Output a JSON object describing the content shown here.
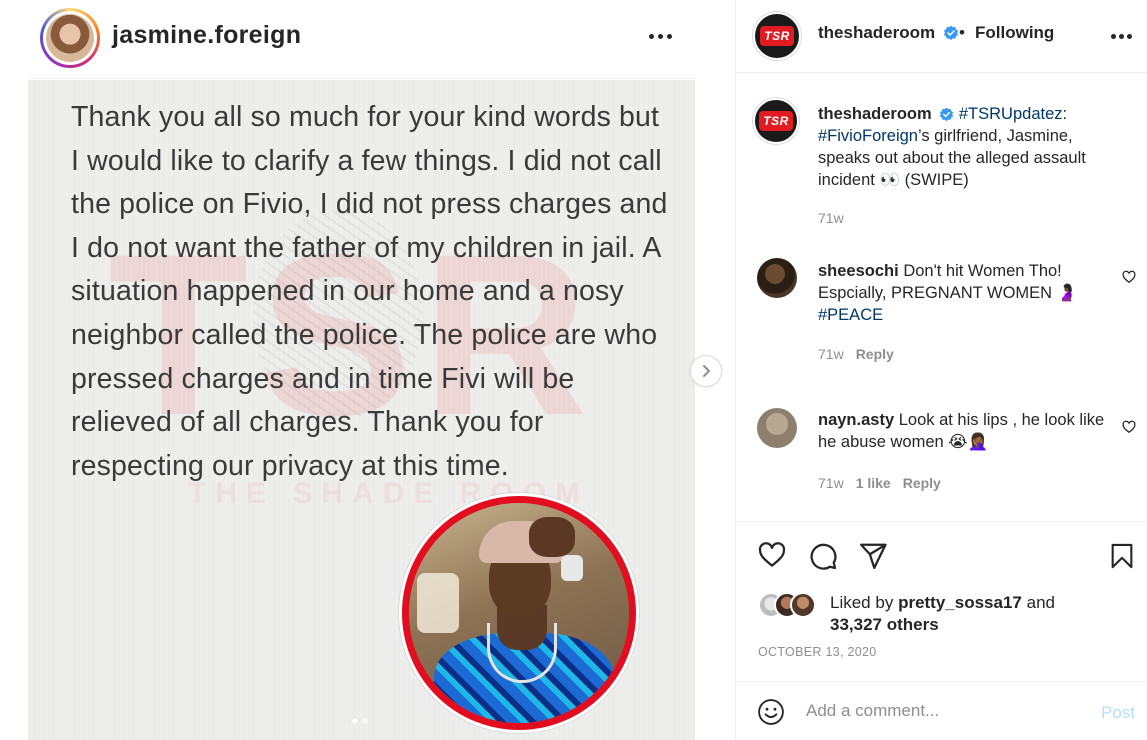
{
  "media": {
    "username": "jasmine.foreign",
    "statement": "Thank you all so much for your kind words but I would like to clarify a few things. I did not call the police on Fivio, I did not press charges and I do not want the father of my children in jail. A situation happened in our home and a nosy neighbor called the police. The police are who pressed charges and in time Fivi will be relieved of all charges. Thank you for respecting our privacy at this time.",
    "watermark_letters": "TSR",
    "watermark_text": "THE SHADE ROOM",
    "carousel_dots": 2,
    "active_dot": 1,
    "accent_color": "#e20e1f"
  },
  "post": {
    "header": {
      "username": "theshaderoom",
      "avatar_mark": "TSR",
      "bullet": "•",
      "following_label": "Following",
      "verified_color": "#3897f0"
    },
    "caption": {
      "username": "theshaderoom",
      "hashtag1": "#TSRUpdatez",
      "sep1": ":",
      "hashtag2": "#FivioForeign",
      "text": "’s girlfriend, Jasmine, speaks out about the alleged assault incident 👀 (SWIPE)",
      "time": "71w"
    },
    "comments": [
      {
        "username": "sheesochi",
        "text": "Don't hit Women Tho! Espcially, PREGNANT WOMEN 🤰🏿",
        "tag": "#PEACE",
        "time": "71w",
        "likes": "",
        "reply": "Reply"
      },
      {
        "username": "nayn.asty",
        "text": "Look at his lips , he look like he abuse women 😭🤦🏾‍♀️",
        "tag": "",
        "time": "71w",
        "likes": "1 like",
        "reply": "Reply"
      }
    ],
    "liked_by": {
      "prefix": "Liked by",
      "user": "pretty_sossa17",
      "and": "and",
      "others": "33,327 others"
    },
    "date": "OCTOBER 13, 2020",
    "add_comment": {
      "placeholder": "Add a comment...",
      "post_label": "Post",
      "post_color": "#b2dffc"
    }
  }
}
